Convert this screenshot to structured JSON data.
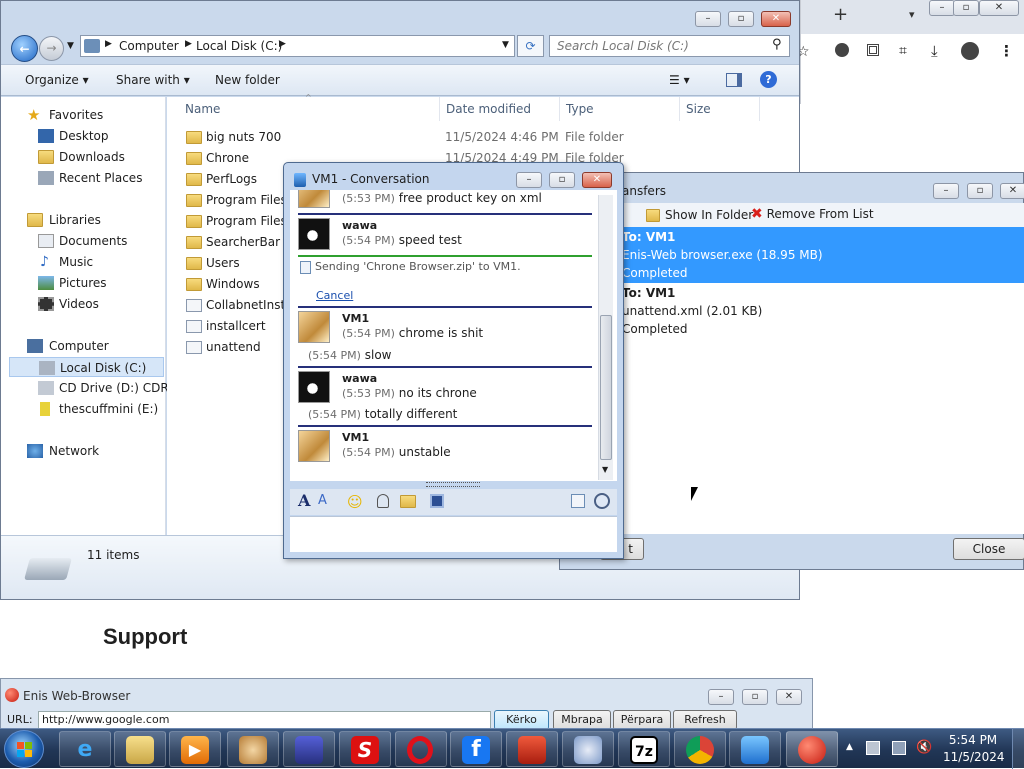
{
  "browser_bg": {
    "new_tab": "+",
    "dropdown": "▾",
    "icons": [
      "star-icon",
      "extensions-icon",
      "apps-icon",
      "crop-icon",
      "download-icon",
      "profile-icon",
      "menu-icon"
    ]
  },
  "explorer": {
    "breadcrumb": [
      "Computer",
      "Local Disk (C:)"
    ],
    "search_placeholder": "Search Local Disk (C:)",
    "commands": {
      "organize": "Organize",
      "share": "Share with",
      "new_folder": "New folder"
    },
    "columns": {
      "name": "Name",
      "date": "Date modified",
      "type": "Type",
      "size": "Size"
    },
    "nav": {
      "favorites": "Favorites",
      "favorites_items": [
        "Desktop",
        "Downloads",
        "Recent Places"
      ],
      "libraries": "Libraries",
      "libraries_items": [
        "Documents",
        "Music",
        "Pictures",
        "Videos"
      ],
      "computer": "Computer",
      "computer_items": [
        "Local Disk (C:)",
        "CD Drive (D:) CDROM",
        "thescuffmini (E:)"
      ],
      "network": "Network"
    },
    "files": [
      {
        "name": "big nuts 700",
        "date": "11/5/2024 4:46 PM",
        "type": "File folder"
      },
      {
        "name": "Chrone",
        "date": "11/5/2024 4:49 PM",
        "type": "File folder"
      },
      {
        "name": "PerfLogs",
        "date": "",
        "type": ""
      },
      {
        "name": "Program Files",
        "date": "",
        "type": ""
      },
      {
        "name": "Program Files (",
        "date": "",
        "type": ""
      },
      {
        "name": "SearcherBar",
        "date": "",
        "type": ""
      },
      {
        "name": "Users",
        "date": "",
        "type": ""
      },
      {
        "name": "Windows",
        "date": "",
        "type": ""
      },
      {
        "name": "CollabnetInsta",
        "date": "",
        "type": ""
      },
      {
        "name": "installcert",
        "date": "",
        "type": ""
      },
      {
        "name": "unattend",
        "date": "",
        "type": ""
      }
    ],
    "status": "11 items"
  },
  "transfers": {
    "title": "ansfers",
    "show_in_folder": "Show In Folder",
    "remove_from_list": "Remove From List",
    "items": [
      {
        "to": "To: VM1",
        "file": "Enis-Web browser.exe (18.95 MB)",
        "status": "Completed",
        "selected": true
      },
      {
        "to": "To: VM1",
        "file": "unattend.xml (2.01 KB)",
        "status": "Completed",
        "selected": false
      }
    ],
    "left_button_tail": "t",
    "close_label": "Close"
  },
  "conversation": {
    "title": "VM1 - Conversation",
    "messages": [
      {
        "who": "",
        "time": "(5:53 PM)",
        "text": "free product key on xml",
        "avatar": "cat"
      },
      {
        "who": "wawa",
        "time": "(5:54 PM)",
        "text": "speed test",
        "avatar": "dog"
      },
      {
        "who": "VM1",
        "time": "(5:54 PM)",
        "text": "chrome is shit",
        "avatar": "cat",
        "extra_time": "(5:54 PM)",
        "extra_text": "slow"
      },
      {
        "who": "wawa",
        "time": "(5:53 PM)",
        "text": "no its chrone",
        "avatar": "dog",
        "extra_time": "(5:54 PM)",
        "extra_text": "totally different"
      },
      {
        "who": "VM1",
        "time": "(5:54 PM)",
        "text": "unstable",
        "avatar": "cat"
      }
    ],
    "transfer_notice": "Sending 'Chrone Browser.zip' to VM1.",
    "cancel": "Cancel"
  },
  "support_heading": "Support",
  "enis_browser": {
    "title": "Enis Web-Browser",
    "url_label": "URL:",
    "url": "http://www.google.com",
    "buttons": [
      "Kërko",
      "Mbrapa",
      "Përpara",
      "Refresh"
    ]
  },
  "taskbar": {
    "time": "5:54 PM",
    "date": "11/5/2024",
    "apps": [
      "ie-icon",
      "explorer-icon",
      "media-player-icon",
      "paint-icon",
      "app-icon",
      "s-icon",
      "opera-icon",
      "facebook-icon",
      "red-app-icon",
      "paint2-icon",
      "7zip-icon",
      "browser-icon",
      "messenger-icon",
      "apple-icon"
    ],
    "seven_zip": "7z"
  }
}
